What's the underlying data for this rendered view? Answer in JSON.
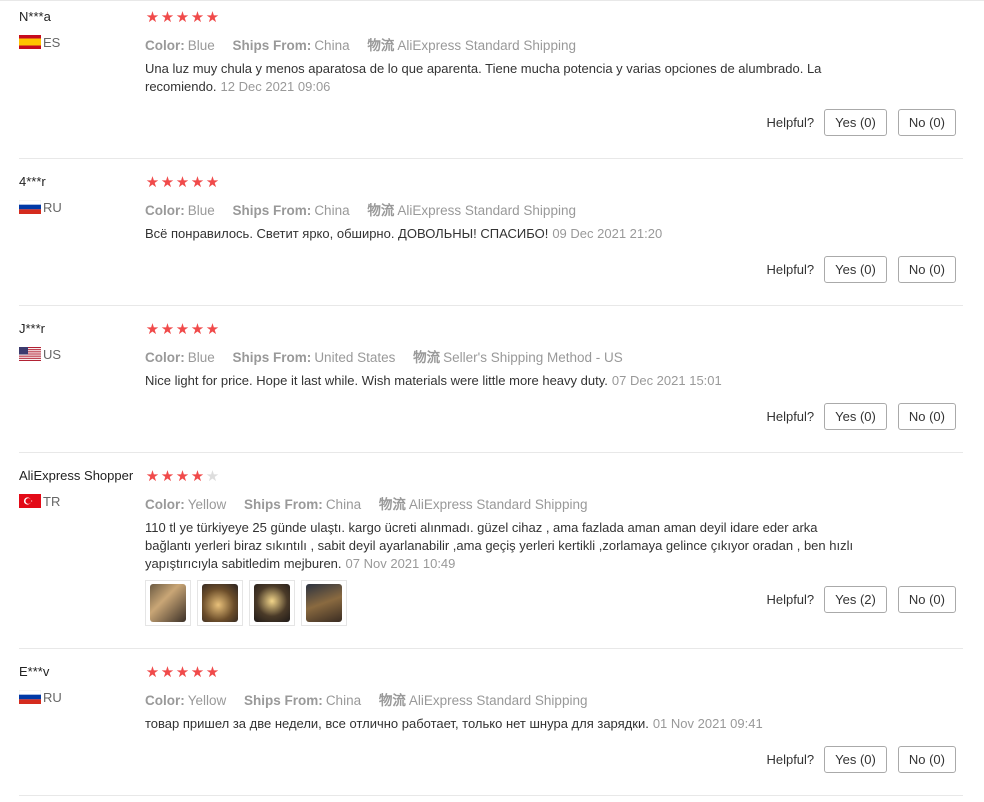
{
  "helpful_label": "Helpful?",
  "reviews": [
    {
      "user": "N***a",
      "country": "ES",
      "stars": 5,
      "color_label": "Color:",
      "color": "Blue",
      "ships_label": "Ships From:",
      "ships_from": "China",
      "logistics_label": "物流",
      "logistics": "AliExpress Standard Shipping",
      "text": "Una luz muy chula y menos aparatosa de lo que aparenta. Tiene mucha potencia y varias opciones de alumbrado. La recomiendo.",
      "date": "12 Dec 2021 09:06",
      "yes": "Yes (0)",
      "no": "No (0)"
    },
    {
      "user": "4***r",
      "country": "RU",
      "stars": 5,
      "color_label": "Color:",
      "color": "Blue",
      "ships_label": "Ships From:",
      "ships_from": "China",
      "logistics_label": "物流",
      "logistics": "AliExpress Standard Shipping",
      "text": "Всё понравилось. Светит ярко, обширно. ДОВОЛЬНЫ! СПАСИБО!",
      "date": "09 Dec 2021 21:20",
      "yes": "Yes (0)",
      "no": "No (0)"
    },
    {
      "user": "J***r",
      "country": "US",
      "stars": 5,
      "color_label": "Color:",
      "color": "Blue",
      "ships_label": "Ships From:",
      "ships_from": "United States",
      "logistics_label": "物流",
      "logistics": "Seller's Shipping Method - US",
      "text": "Nice light for price. Hope it last while. Wish materials were little more heavy duty.",
      "date": "07 Dec 2021 15:01",
      "yes": "Yes (0)",
      "no": "No (0)"
    },
    {
      "user": "AliExpress Shopper",
      "country": "TR",
      "stars": 4,
      "color_label": "Color:",
      "color": "Yellow",
      "ships_label": "Ships From:",
      "ships_from": "China",
      "logistics_label": "物流",
      "logistics": "AliExpress Standard Shipping",
      "text": "110 tl ye türkiyeye 25 günde ulaştı. kargo ücreti alınmadı. güzel cihaz , ama fazlada aman aman deyil idare eder arka bağlantı yerleri biraz sıkıntılı , sabit deyil ayarlanabilir ,ama geçiş yerleri kertikli ,zorlamaya gelince çıkıyor oradan , ben hızlı yapıştırıcıyla sabitledim mejburen.",
      "date": "07 Nov 2021 10:49",
      "photos": 4,
      "yes": "Yes (2)",
      "no": "No (0)"
    },
    {
      "user": "E***v",
      "country": "RU",
      "stars": 5,
      "color_label": "Color:",
      "color": "Yellow",
      "ships_label": "Ships From:",
      "ships_from": "China",
      "logistics_label": "物流",
      "logistics": "AliExpress Standard Shipping",
      "text": "товар пришел за две недели, все отлично работает, только нет шнура для зарядки.",
      "date": "01 Nov 2021 09:41",
      "yes": "Yes (0)",
      "no": "No (0)"
    }
  ]
}
